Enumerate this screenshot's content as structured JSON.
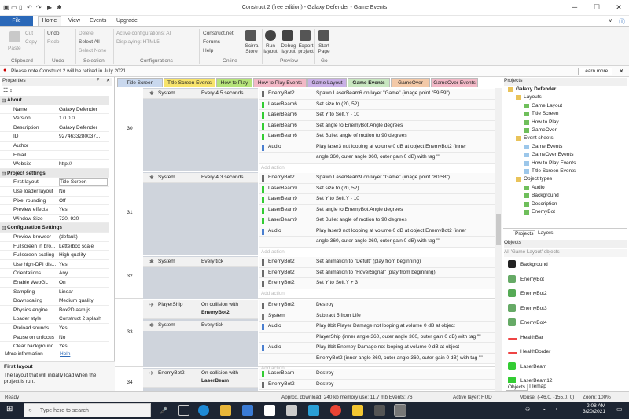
{
  "window": {
    "title": "Construct 2  (free edition) - Galaxy Defender - Game Events"
  },
  "ribbon_tabs": [
    "File",
    "Home",
    "View",
    "Events",
    "Upgrade"
  ],
  "ribbon": {
    "clipboard": {
      "paste": "Paste",
      "cut": "Cut",
      "copy": "Copy",
      "group": "Clipboard"
    },
    "undo": {
      "undo": "Undo",
      "redo": "Redo",
      "group": "Undo"
    },
    "selection": {
      "delete": "Delete",
      "select_all": "Select All",
      "select_none": "Select None",
      "group": "Selection"
    },
    "configurations": {
      "active": "Active configurations: All",
      "displaying": "Displaying: HTML5",
      "group": "Configurations"
    },
    "online": {
      "construct": "Construct.net",
      "forums": "Forums",
      "help": "Help",
      "store": "Scirra Store",
      "group": "Online"
    },
    "preview": {
      "run": "Run layout",
      "debug": "Debug layout",
      "export": "Export project",
      "group": "Preview"
    },
    "go": {
      "start": "Start Page",
      "group": "Go"
    }
  },
  "notice": {
    "text": "Please note Construct 2 will be retired in July 2021.",
    "button": "Learn more"
  },
  "properties": {
    "title": "Properties",
    "rows": [
      {
        "k": "About",
        "sec": true
      },
      {
        "k": "Name",
        "v": "Galaxy Defender"
      },
      {
        "k": "Version",
        "v": "1.0.0.0"
      },
      {
        "k": "Description",
        "v": "Galaxy Defender"
      },
      {
        "k": "ID",
        "v": "9274633280037..."
      },
      {
        "k": "Author",
        "v": ""
      },
      {
        "k": "Email",
        "v": ""
      },
      {
        "k": "Website",
        "v": "http://"
      },
      {
        "k": "Project settings",
        "sec": true
      },
      {
        "k": "First layout",
        "v": "Title Screen"
      },
      {
        "k": "Use loader layout",
        "v": "No"
      },
      {
        "k": "Pixel rounding",
        "v": "Off"
      },
      {
        "k": "Preview effects",
        "v": "Yes"
      },
      {
        "k": "Window Size",
        "v": "720, 920"
      },
      {
        "k": "Configuration Settings",
        "sec": true
      },
      {
        "k": "Preview browser",
        "v": "(default)"
      },
      {
        "k": "Fullscreen in bro...",
        "v": "Letterbox scale"
      },
      {
        "k": "Fullscreen scaling",
        "v": "High quality"
      },
      {
        "k": "Use high-DPI dis...",
        "v": "Yes"
      },
      {
        "k": "Orientations",
        "v": "Any"
      },
      {
        "k": "Enable WebGL",
        "v": "On"
      },
      {
        "k": "Sampling",
        "v": "Linear"
      },
      {
        "k": "Downscaling",
        "v": "Medium quality"
      },
      {
        "k": "Physics engine",
        "v": "Box2D asm.js"
      },
      {
        "k": "Loader style",
        "v": "Construct 2 splash"
      },
      {
        "k": "Preload sounds",
        "v": "Yes"
      },
      {
        "k": "Pause on unfocus",
        "v": "No"
      },
      {
        "k": "Clear background",
        "v": "Yes"
      }
    ],
    "more_info": "More information",
    "help_link": "Help",
    "desc_title": "First layout",
    "desc_text": "The layout that will initially load when the project is run."
  },
  "tabs": [
    "Title Screen",
    "Title Screen Events",
    "How to Play",
    "How to Play Events",
    "Game Layout",
    "Game Events",
    "GameOver",
    "GameOver Events"
  ],
  "events": {
    "e30": {
      "num": "30",
      "obj": "System",
      "cond": "Every 4.5 seconds",
      "acts": [
        {
          "o": "EnemyBot2",
          "t": "Spawn  LaserBeam6 on layer \"Game\" (image point \"59,59\")"
        },
        {
          "o": "LaserBeam6",
          "t": "Set size to (20, 52)"
        },
        {
          "o": "LaserBeam6",
          "t": "Set Y to Self.Y - 10"
        },
        {
          "o": "LaserBeam6",
          "t": "Set angle to EnemyBot.Angle degrees"
        },
        {
          "o": "LaserBeam6",
          "t": "Set  Bullet angle of motion to 90 degrees"
        },
        {
          "o": "Audio",
          "t": "Play laser3 not looping at volume 0 dB at object  EnemyBot2 (inner"
        },
        {
          "o": "",
          "t": "angle 360, outer angle 360, outer gain 0 dB) with tag \"\""
        }
      ],
      "add": "Add action"
    },
    "e31": {
      "num": "31",
      "obj": "System",
      "cond": "Every 4.3 seconds",
      "acts": [
        {
          "o": "EnemyBot2",
          "t": "Spawn  LaserBeam9 on layer \"Game\" (image point \"80,58\")"
        },
        {
          "o": "LaserBeam9",
          "t": "Set size to (20, 52)"
        },
        {
          "o": "LaserBeam9",
          "t": "Set Y to Self.Y - 10"
        },
        {
          "o": "LaserBeam9",
          "t": "Set angle to EnemyBot.Angle degrees"
        },
        {
          "o": "LaserBeam9",
          "t": "Set  Bullet angle of motion to 90 degrees"
        },
        {
          "o": "Audio",
          "t": "Play laser3 not looping at volume 0 dB at object  EnemyBot2 (inner"
        },
        {
          "o": "",
          "t": "angle 360, outer angle 360, outer gain 0 dB) with tag \"\""
        }
      ],
      "add": "Add action"
    },
    "e32": {
      "num": "32",
      "obj": "System",
      "cond": "Every tick",
      "acts": [
        {
          "o": "EnemyBot2",
          "t": "Set animation to \"Defult\" (play from beginning)"
        },
        {
          "o": "EnemyBot2",
          "t": "Set animation to \"HoverSignal\" (play from beginning)"
        },
        {
          "o": "EnemyBot2",
          "t": "Set Y to Self.Y + 3"
        }
      ],
      "add": "Add action"
    },
    "e33": {
      "num": "33",
      "obj": "PlayerShip",
      "cond": "On collision with",
      "cond2": "EnemyBot2",
      "obj2": "System",
      "cond3": "Every tick",
      "acts": [
        {
          "o": "EnemyBot2",
          "t": "Destroy"
        },
        {
          "o": "System",
          "t": "Subtract 5 from Life"
        },
        {
          "o": "Audio",
          "t": "Play 8bit Player Damage not looping at volume 0 dB at object"
        },
        {
          "o": "",
          "t": "PlayerShip (inner angle 360, outer angle 360, outer gain 0 dB) with tag \"\""
        },
        {
          "o": "Audio",
          "t": "Play 8bit Enemey Damage not looping at volume 0 dB at object"
        },
        {
          "o": "",
          "t": "EnemyBot2 (inner angle 360, outer angle 360, outer gain 0 dB) with tag \"\""
        }
      ],
      "add": "Add action"
    },
    "e34": {
      "num": "34",
      "obj": "EnemyBot2",
      "cond": "On collision with",
      "cond2": "LaserBeam",
      "acts": [
        {
          "o": "LaserBeam",
          "t": "Destroy"
        },
        {
          "o": "EnemyBot2",
          "t": "Destroy"
        }
      ]
    }
  },
  "projects": {
    "title": "Projects",
    "tree": [
      "Galaxy Defender",
      "Layouts",
      "Game Layout",
      "Title Screen",
      "How to Play",
      "GameOver",
      "Event sheets",
      "Game Events",
      "GameOver Events",
      "How to Play Events",
      "Title Screen Events",
      "Object types",
      "Audio",
      "Background",
      "Description",
      "EnemyBot"
    ],
    "tabs": [
      "Projects",
      "Layers"
    ]
  },
  "objects": {
    "title": "Objects",
    "filter": "All 'Game Layout' objects",
    "items": [
      "Background",
      "EnemyBot",
      "EnemyBot2",
      "EnemyBot3",
      "EnemyBot4",
      "HealthBar",
      "HealthBorder",
      "LaserBeam",
      "LaserBeam12"
    ],
    "tabs": [
      "Objects",
      "Tilemap"
    ]
  },
  "status": {
    "ready": "Ready",
    "download": "Approx. download: 240 kb  memory use: 11.7 mb  Events: 76",
    "layer": "Active layer: HUD",
    "mouse": "Mouse: (-46.0, -155.0, 0)",
    "zoom": "Zoom: 100%"
  },
  "taskbar": {
    "search": "Type here to search",
    "time": "2:08 AM",
    "date": "3/20/2021"
  }
}
